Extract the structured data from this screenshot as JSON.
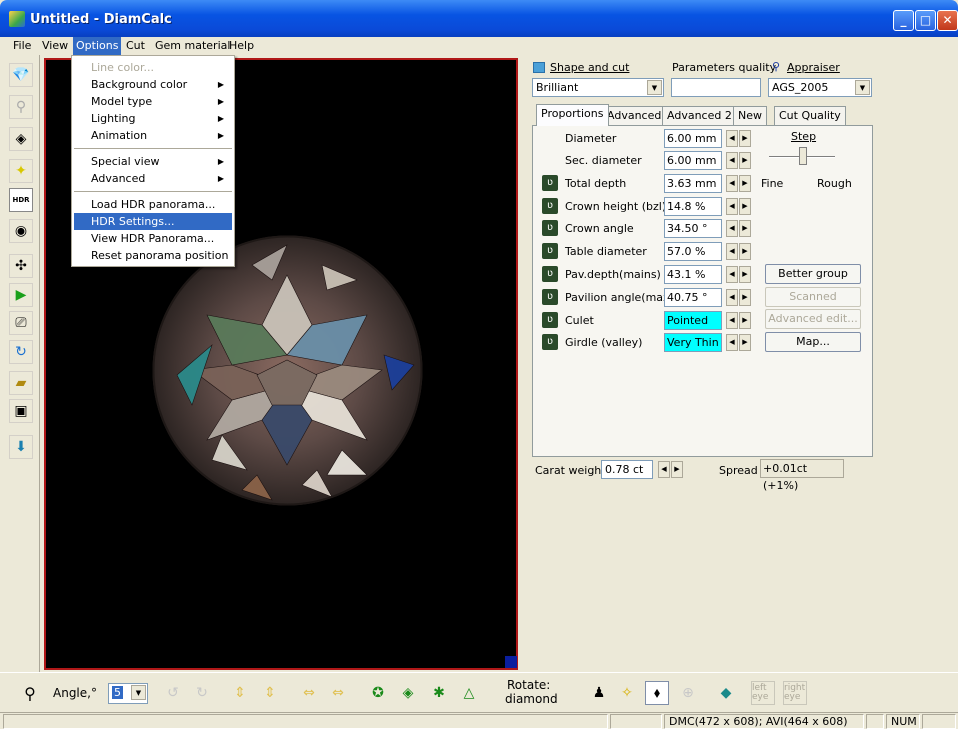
{
  "window": {
    "title": "Untitled - DiamCalc"
  },
  "menubar": [
    "File",
    "View",
    "Options",
    "Cut",
    "Gem material",
    "Help"
  ],
  "options_menu": {
    "items": [
      {
        "label": "Line color...",
        "disabled": true
      },
      {
        "label": "Background color",
        "submenu": true
      },
      {
        "label": "Model type",
        "submenu": true
      },
      {
        "label": "Lighting",
        "submenu": true
      },
      {
        "label": "Animation",
        "submenu": true
      },
      {
        "label": "Special view",
        "submenu": true
      },
      {
        "label": "Advanced",
        "submenu": true
      },
      {
        "label": "Load HDR panorama..."
      },
      {
        "label": "HDR Settings...",
        "selected": true
      },
      {
        "label": "View HDR Panorama..."
      },
      {
        "label": "Reset panorama position"
      }
    ]
  },
  "left_toolbar": {
    "hdr_label": "HDR"
  },
  "panel": {
    "shape_label": "Shape and cut",
    "shape_value": "Brilliant",
    "quality_label": "Parameters quality",
    "quality_value": "",
    "appraiser_label": "Appraiser",
    "appraiser_value": "AGS_2005",
    "tabs": [
      "Proportions",
      "Advanced",
      "Advanced 2",
      "New",
      "Cut Quality"
    ],
    "params": [
      {
        "label": "Diameter",
        "value": "6.00 mm",
        "icon": false
      },
      {
        "label": "Sec. diameter",
        "value": "6.00 mm",
        "icon": false
      },
      {
        "label": "Total depth",
        "value": "3.63 mm",
        "icon": true
      },
      {
        "label": "Crown height (bzl)",
        "value": "14.8 %",
        "icon": true
      },
      {
        "label": "Crown angle",
        "value": "34.50 °",
        "icon": true
      },
      {
        "label": "Table diameter",
        "value": "57.0 %",
        "icon": true
      },
      {
        "label": "Pav.depth(mains)",
        "value": "43.1 %",
        "icon": true
      },
      {
        "label": "Pavilion angle(max)",
        "value": "40.75 °",
        "icon": true
      },
      {
        "label": "Culet",
        "value": "Pointed",
        "icon": true,
        "highlight": true
      },
      {
        "label": "Girdle (valley)",
        "value": "Very Thin",
        "icon": true,
        "highlight": true
      }
    ],
    "step_label": "Step",
    "fine_label": "Fine",
    "rough_label": "Rough",
    "buttons": [
      {
        "label": "Better group",
        "disabled": false
      },
      {
        "label": "Scanned reports...",
        "disabled": true
      },
      {
        "label": "Advanced edit...",
        "disabled": true
      },
      {
        "label": "Map...",
        "disabled": false
      }
    ],
    "carat_label": "Carat weight",
    "carat_value": "0.78 ct",
    "spread_label": "Spread",
    "spread_value": "+0.01ct (+1%)"
  },
  "bottom": {
    "angle_label": "Angle,°",
    "angle_value": "5",
    "rotate_label": "Rotate:",
    "rotate_value": "diamond",
    "left_eye": "left eye",
    "right_eye": "right eye"
  },
  "status": {
    "dims": "DMC(472 x 608); AVI(464 x 608)",
    "num": "NUM"
  }
}
